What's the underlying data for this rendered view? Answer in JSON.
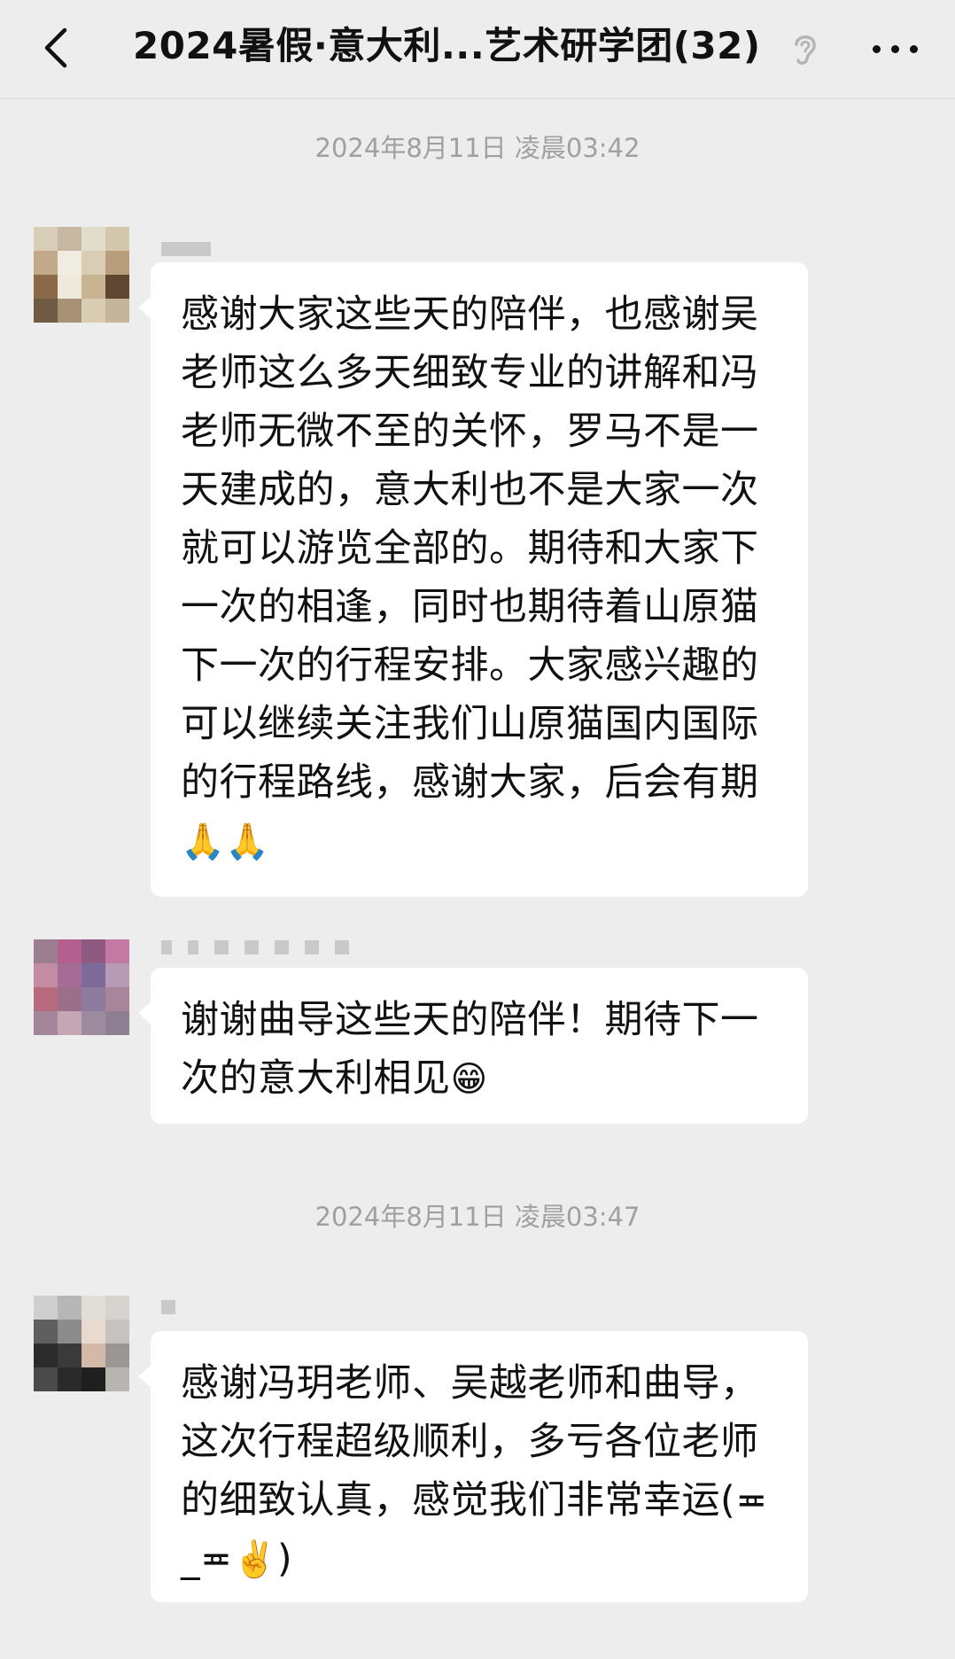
{
  "header": {
    "title": "2024暑假·意大利...艺术研学团(32)"
  },
  "timestamps": [
    "2024年8月11日 凌晨03:42",
    "2024年8月11日 凌晨03:47"
  ],
  "messages": [
    {
      "text": "感谢大家这些天的陪伴，也感谢吴老师这么多天细致专业的讲解和冯老师无微不至的关怀，罗马不是一天建成的，意大利也不是大家一次就可以游览全部的。期待和大家下一次的相逢，同时也期待着山原猫下一次的行程安排。大家感兴趣的可以继续关注我们山原猫国内国际的行程路线，感谢大家，后会有期",
      "emoji": "🙏🙏"
    },
    {
      "text": "谢谢曲导这些天的陪伴！期待下一次的意大利相见",
      "emoji": "😁"
    },
    {
      "text": "感谢冯玥老师、吴越老师和曲导，这次行程超级顺利，多亏各位老师的细致认真，感觉我们非常幸运(≖_≖",
      "emoji": "✌️",
      "text_after": ")"
    }
  ],
  "icons": {
    "back": "chevron-left-icon",
    "ear": "ear-icon",
    "more": "more-dots-icon"
  },
  "colors": {
    "background": "#ededed",
    "bubble": "#ffffff",
    "timestamp": "#a0a0a0",
    "text": "#111111"
  }
}
